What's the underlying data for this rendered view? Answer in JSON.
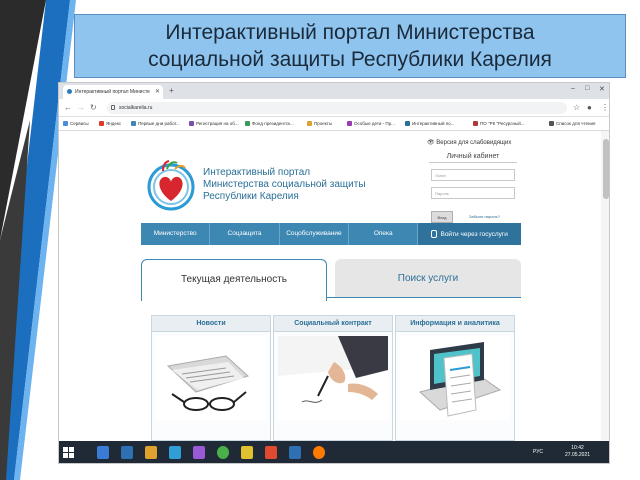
{
  "slide": {
    "title": "Интерактивный портал Министерства социальной защиты Республики Карелия"
  },
  "browser": {
    "tab_title": "Интерактивный портал Министе",
    "new_tab": "+",
    "window_controls": [
      "–",
      "□",
      "✕"
    ],
    "tab_close": "✕",
    "url": "socialkarelia.ru",
    "bookmarks": [
      {
        "label": "Сервисы",
        "color": "#4a8de0"
      },
      {
        "label": "Яндекс",
        "color": "#e03a2f"
      },
      {
        "label": "Первые дни работ...",
        "color": "#3d87b3"
      },
      {
        "label": "Регистрация на об...",
        "color": "#7b4fb0"
      },
      {
        "label": "Фонд президентск...",
        "color": "#3a9a5b"
      },
      {
        "label": "Проекты",
        "color": "#e0a22f"
      },
      {
        "label": "Особые дети - Пр...",
        "color": "#9a3ab0"
      },
      {
        "label": "Интерактивный по...",
        "color": "#2a6f97"
      },
      {
        "label": "ПО \"РК \"Ресурсный...",
        "color": "#b03a3a"
      },
      {
        "label": "Список для чтения",
        "color": "#555555"
      }
    ]
  },
  "site": {
    "low_vision": "Версия для слабовидящих",
    "title_lines": [
      "Интерактивный портал",
      "Министерства социальной защиты",
      "Республики Карелия"
    ],
    "login": {
      "title": "Личный кабинет",
      "login_placeholder": "Логин",
      "password_placeholder": "Пароль",
      "submit": "Вход",
      "forgot": "Забыли пароль?"
    },
    "menu": [
      "Министерство",
      "Соцзащита",
      "Соцобслуживание",
      "Опека",
      "Войти через госуслуги"
    ],
    "tabs": {
      "active": "Текущая деятельность",
      "inactive": "Поиск услуги"
    },
    "cards": [
      "Новости",
      "Социальный контракт",
      "Информация и аналитика"
    ]
  },
  "taskbar": {
    "lang": "РУС",
    "time": "10:42",
    "date": "27.05.2021",
    "icon_colors": [
      "#3a7bd5",
      "#2f6fb3",
      "#e0a22f",
      "#2f9fd5",
      "#9a5ad5",
      "#4ab04a",
      "#e0c02f",
      "#e04a2f",
      "#2f6fb3",
      "#ff7a00"
    ]
  }
}
